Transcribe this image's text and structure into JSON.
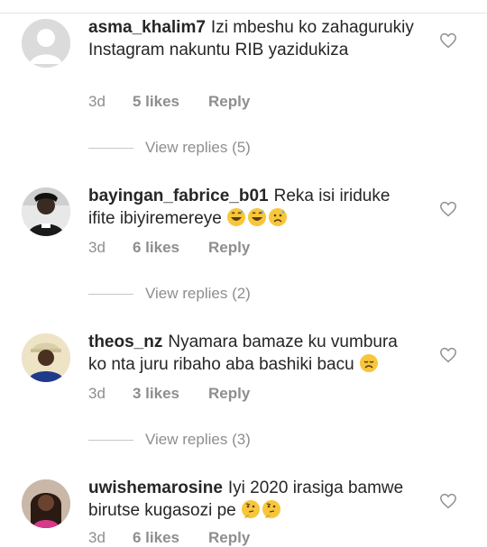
{
  "comments": [
    {
      "username": "asma_khalim7",
      "text": "Izi mbeshu ko zahagurukiy Instagram nakuntu RIB yazidukiza",
      "emojis": [],
      "time": "3d",
      "likes": "5 likes",
      "reply_label": "Reply",
      "view_replies": "View replies (5)",
      "avatar": "default-avatar"
    },
    {
      "username": "bayingan_fabrice_b01",
      "text": "Reka isi iriduke ifite ibiyiremereye",
      "emojis": [
        "grinning-sweat-emoji",
        "grinning-sweat-emoji",
        "cold-sweat-emoji"
      ],
      "time": "3d",
      "likes": "6 likes",
      "reply_label": "Reply",
      "view_replies": "View replies (2)",
      "avatar": "user-photo"
    },
    {
      "username": "theos_nz",
      "text": "Nyamara bamaze ku vumbura ko nta juru ribaho aba bashiki bacu",
      "emojis": [
        "disappointed-emoji"
      ],
      "time": "3d",
      "likes": "3 likes",
      "reply_label": "Reply",
      "view_replies": "View replies (3)",
      "avatar": "user-photo"
    },
    {
      "username": "uwishemarosine",
      "text": "Iyi 2020 irasiga bamwe birutse kugasozi pe",
      "emojis": [
        "thinking-emoji",
        "thinking-emoji"
      ],
      "time": "3d",
      "likes": "6 likes",
      "reply_label": "Reply",
      "view_replies": "",
      "avatar": "user-photo"
    }
  ],
  "colors": {
    "text": "#262626",
    "muted": "#8e8e8e",
    "divider": "#c7c7c7",
    "emoji": "#f7c63a"
  },
  "icons": {
    "like": "heart-outline-icon"
  }
}
